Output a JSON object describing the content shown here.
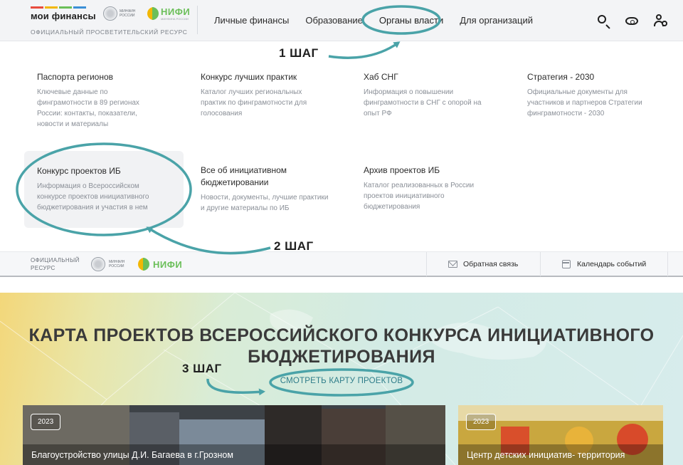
{
  "header": {
    "brand_name": "мои финансы",
    "brand_sub": "ОФИЦИАЛЬНЫЙ ПРОСВЕТИТЕЛЬСКИЙ РЕСУРС",
    "brand_colors": [
      "#e84c3d",
      "#f2b705",
      "#6bbf59",
      "#3a8fd6"
    ],
    "minfin_text": "МИНФИН РОССИИ",
    "nifi_text": "НИФИ",
    "nifi_sub": "МИНФИНА РОССИИ",
    "nav": [
      {
        "label": "Личные финансы"
      },
      {
        "label": "Образование"
      },
      {
        "label": "Органы власти"
      },
      {
        "label": "Для организаций"
      }
    ],
    "icons": [
      "search-icon",
      "eye-icon",
      "user-settings-icon"
    ]
  },
  "dropdown": {
    "cards": [
      {
        "title": "Паспорта регионов",
        "desc": "Ключевые данные по финграмотности в 89 регионах России: контакты, показатели, новости и материалы"
      },
      {
        "title": "Конкурс лучших практик",
        "desc": "Каталог лучших региональных практик по финграмотности для голосования"
      },
      {
        "title": "Хаб СНГ",
        "desc": "Информация о повышении финграмотности в СНГ с опорой на опыт РФ"
      },
      {
        "title": "Стратегия - 2030",
        "desc": "Официальные документы для участников и партнеров Стратегии финграмотности - 2030"
      },
      {
        "title": "Конкурс проектов ИБ",
        "desc": "Информация о Всероссийском конкурсе проектов инициативного бюджетирования и участия в нем"
      },
      {
        "title": "Все об инициативном бюджетировании",
        "desc": "Новости, документы, лучшие практики и другие материалы по ИБ"
      },
      {
        "title": "Архив проектов ИБ",
        "desc": "Каталог реализованных в России проектов инициативного бюджетирования"
      }
    ]
  },
  "annotations": {
    "step1": "1 ШАГ",
    "step2": "2 ШАГ",
    "step3": "3 ШАГ",
    "color": "#4aa3a8"
  },
  "strip": {
    "label": "ОФИЦИАЛЬНЫЙ РЕСУРС",
    "minfin_text": "МИНФИН РОССИИ",
    "nifi_text": "НИФИ",
    "feedback": "Обратная связь",
    "calendar": "Календарь событий"
  },
  "promo": {
    "title": "КАРТА ПРОЕКТОВ ВСЕРОССИЙСКОГО КОНКУРСА ИНИЦИАТИВНОГО БЮДЖЕТИРОВАНИЯ",
    "link": "СМОТРЕТЬ КАРТУ ПРОЕКТОВ",
    "link_color": "#2f7d8a",
    "cards": [
      {
        "year": "2023",
        "caption": "Благоустройство улицы Д.И. Багаева в г.Грозном"
      },
      {
        "year": "2023",
        "caption": "Центр детских инициатив- территория"
      }
    ]
  }
}
